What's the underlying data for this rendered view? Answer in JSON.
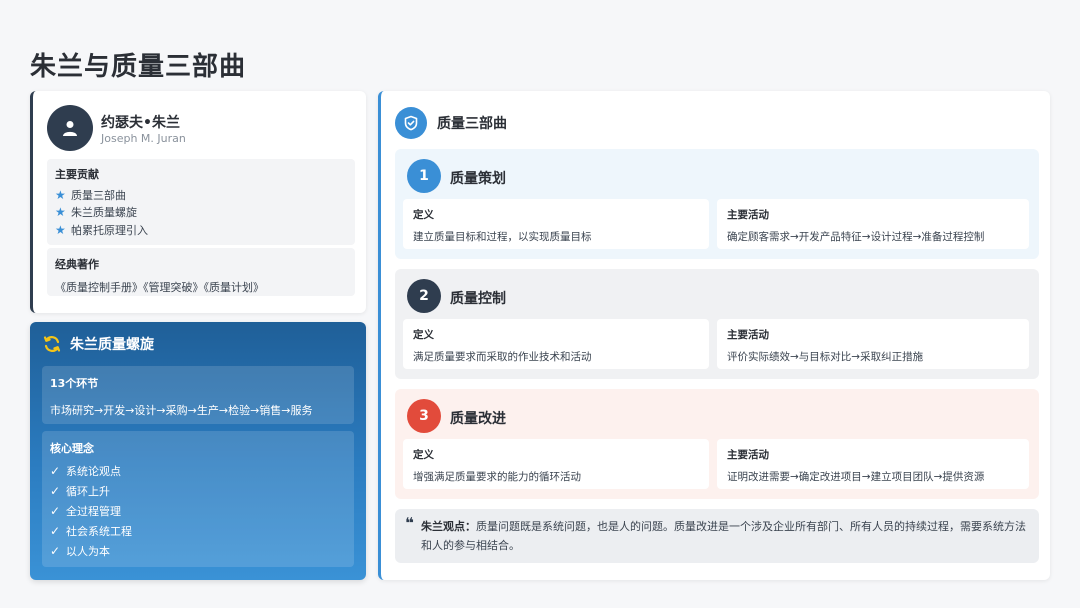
{
  "page": {
    "title": "朱兰与质量三部曲"
  },
  "profile": {
    "avatar_icon": "user-icon",
    "name": "约瑟夫•朱兰",
    "name_en": "Joseph M. Juran",
    "contributions_title": "主要贡献",
    "contributions": [
      "质量三部曲",
      "朱兰质量螺旋",
      "帕累托原理引入"
    ],
    "works_title": "经典著作",
    "works": "《质量控制手册》《管理突破》《质量计划》"
  },
  "spiral": {
    "title": "朱兰质量螺旋",
    "icon": "refresh-icon",
    "steps_title": "13个环节",
    "steps": "市场研究→开发→设计→采购→生产→检验→销售→服务",
    "concepts_title": "核心理念",
    "concepts": [
      "系统论观点",
      "循环上升",
      "全过程管理",
      "社会系统工程",
      "以人为本"
    ]
  },
  "trilogy": {
    "title": "质量三部曲",
    "icon": "shield-icon",
    "sections": [
      {
        "number": "1",
        "title": "质量策划",
        "def_label": "定义",
        "def_text": "建立质量目标和过程，以实现质量目标",
        "act_label": "主要活动",
        "act_text": "确定顾客需求→开发产品特征→设计过程→准备过程控制",
        "color": "#3a8fd6"
      },
      {
        "number": "2",
        "title": "质量控制",
        "def_label": "定义",
        "def_text": "满足质量要求而采取的作业技术和活动",
        "act_label": "主要活动",
        "act_text": "评价实际绩效→与目标对比→采取纠正措施",
        "color": "#2f3d4f"
      },
      {
        "number": "3",
        "title": "质量改进",
        "def_label": "定义",
        "def_text": "增强满足质量要求的能力的循环活动",
        "act_label": "主要活动",
        "act_text": "证明改进需要→确定改进项目→建立项目团队→提供资源",
        "color": "#e24b3b"
      }
    ],
    "quote_lead": "朱兰观点：",
    "quote_text": "质量问题既是系统问题，也是人的问题。质量改进是一个涉及企业所有部门、所有人员的持续过程，需要系统方法和人的参与相结合。"
  }
}
